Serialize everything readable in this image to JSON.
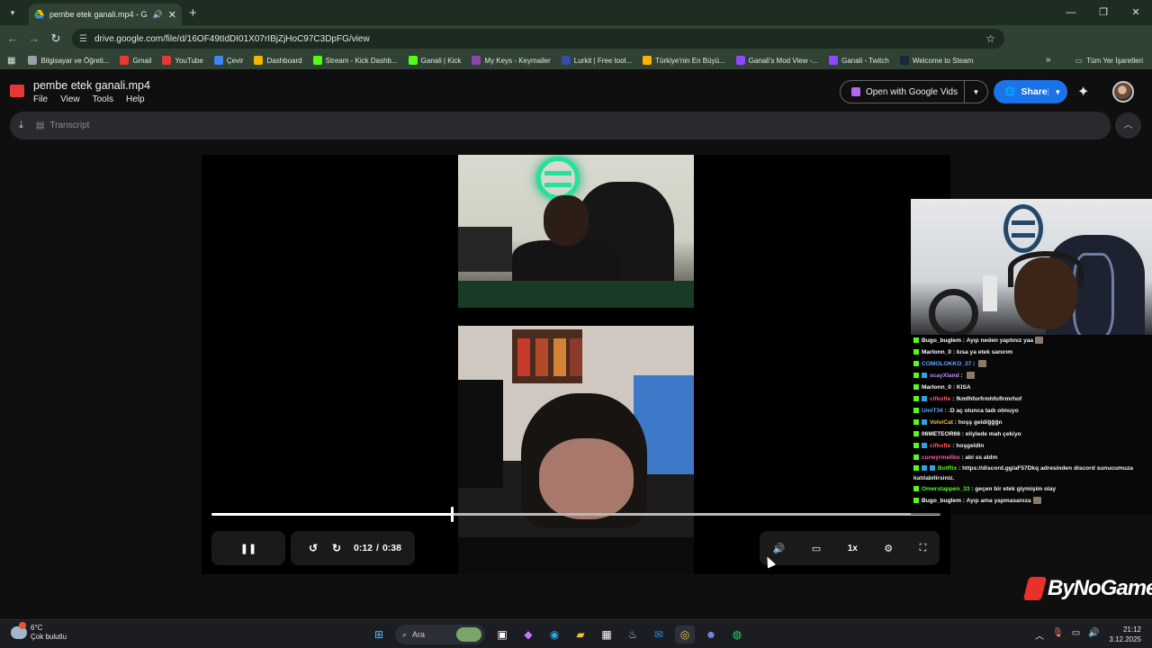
{
  "browser": {
    "tab_title": "pembe etek ganali.mp4 - G",
    "url": "drive.google.com/file/d/16OF49tIdDI01X07rIBjZjHoC97C3DpFG/view",
    "bookmarks": [
      {
        "label": "Bilgisayar ve Öğreti...",
        "color": "#9aa0a6"
      },
      {
        "label": "Gmail",
        "color": "#e53935"
      },
      {
        "label": "YouTube",
        "color": "#e53935"
      },
      {
        "label": "Çevir",
        "color": "#4285f4"
      },
      {
        "label": "Dashboard",
        "color": "#f4b400"
      },
      {
        "label": "Stream - Kick Dashb...",
        "color": "#53fc18"
      },
      {
        "label": "Ganali | Kick",
        "color": "#53fc18"
      },
      {
        "label": "My Keys - Keymailer",
        "color": "#8e44ad"
      },
      {
        "label": "Lurkit | Free tool...",
        "color": "#3949ab"
      },
      {
        "label": "Türkiye'nin En Büyü...",
        "color": "#ffb300"
      },
      {
        "label": "Ganali's Mod View -...",
        "color": "#9146ff"
      },
      {
        "label": "Ganali - Twitch",
        "color": "#9146ff"
      },
      {
        "label": "Welcome to Steam",
        "color": "#1b2838"
      }
    ],
    "all_bookmarks": "Tüm Yer İşaretleri"
  },
  "drive": {
    "file_title": "pembe etek ganali.mp4",
    "menus": [
      "File",
      "View",
      "Tools",
      "Help"
    ],
    "open_with": "Open with Google Vids",
    "share": "Share",
    "transcript": "Transcript"
  },
  "player": {
    "current_time": "0:12",
    "duration": "0:38",
    "progress": 0.33,
    "speed": "1x"
  },
  "chat": [
    {
      "user": "Bugo_buglem",
      "color": "#ffffff",
      "text": "Ayıp neden yaptınız yaa",
      "emote": true,
      "badges": 1
    },
    {
      "user": "Marlonn_0",
      "color": "#ffffff",
      "text": "kısa ya etek sanırım",
      "badges": 1
    },
    {
      "user": "COMOLOKKO_37",
      "color": "#5aa9ff",
      "text": "",
      "badges": 1,
      "emote": true
    },
    {
      "user": "scayXland",
      "color": "#c08bff",
      "text": "",
      "badges": 2,
      "emote": true
    },
    {
      "user": "Marlonn_0",
      "color": "#ffffff",
      "text": "KISA",
      "badges": 1
    },
    {
      "user": "cifkofte",
      "color": "#ff5a5a",
      "text": "fkmfhforfrmhfoflrmrhof",
      "badges": 2
    },
    {
      "user": "UmiT34",
      "color": "#5aa9ff",
      "text": ":D aç olunca tadı olmuyo",
      "badges": 1
    },
    {
      "user": "VolviCat",
      "color": "#ffb84d",
      "text": "hoşş geldiğğğn",
      "badges": 2
    },
    {
      "user": "06METEOR66",
      "color": "#ffffff",
      "text": "eliylede mah çekiyo",
      "badges": 1
    },
    {
      "user": "cifkofte",
      "color": "#ff5a5a",
      "text": "hoşgeldin",
      "badges": 2
    },
    {
      "user": "cuneyrmeliko",
      "color": "#ff5aa8",
      "text": "abi ss aldm",
      "badges": 1
    },
    {
      "user": "BotRix",
      "color": "#53fc18",
      "text": "https://discord.gg/aF57Dkq adresinden discord sunucumuza katılabilirsiniz.",
      "badges": 3
    },
    {
      "user": "Omerstappen_33",
      "color": "#53fc18",
      "text": "geçen bir etek giymişim olay",
      "badges": 1
    },
    {
      "user": "Bugo_buglem",
      "color": "#ffffff",
      "text": "Ayıp ama yapmasanıza",
      "emote": true,
      "badges": 1
    }
  ],
  "watermark": "ByNoGame",
  "taskbar": {
    "temp": "6°C",
    "weather": "Çok bulutlu",
    "search": "Ara",
    "time": "21:12",
    "date": "3.12.2025"
  }
}
